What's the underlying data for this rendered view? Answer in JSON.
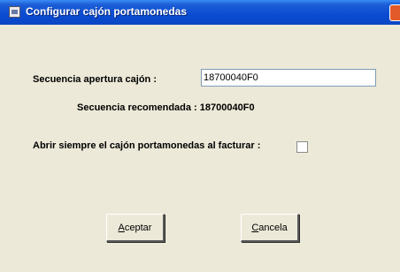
{
  "window": {
    "title": "Configurar cajón portamonedas"
  },
  "form": {
    "sequence_label": "Secuencia apertura cajón :",
    "sequence_value": "18700040F0",
    "recommended_label": "Secuencia recomendada : 18700040F0",
    "always_open_label": "Abrir siempre el cajón portamonedas al facturar :",
    "always_open_checked": false
  },
  "buttons": {
    "accept_mnemonic": "A",
    "accept_rest": "ceptar",
    "cancel_mnemonic": "C",
    "cancel_rest": "ancela"
  },
  "colors": {
    "titlebar": "#0a4bd2",
    "dialog_bg": "#ece9d8",
    "close_button": "#e35a2a"
  }
}
